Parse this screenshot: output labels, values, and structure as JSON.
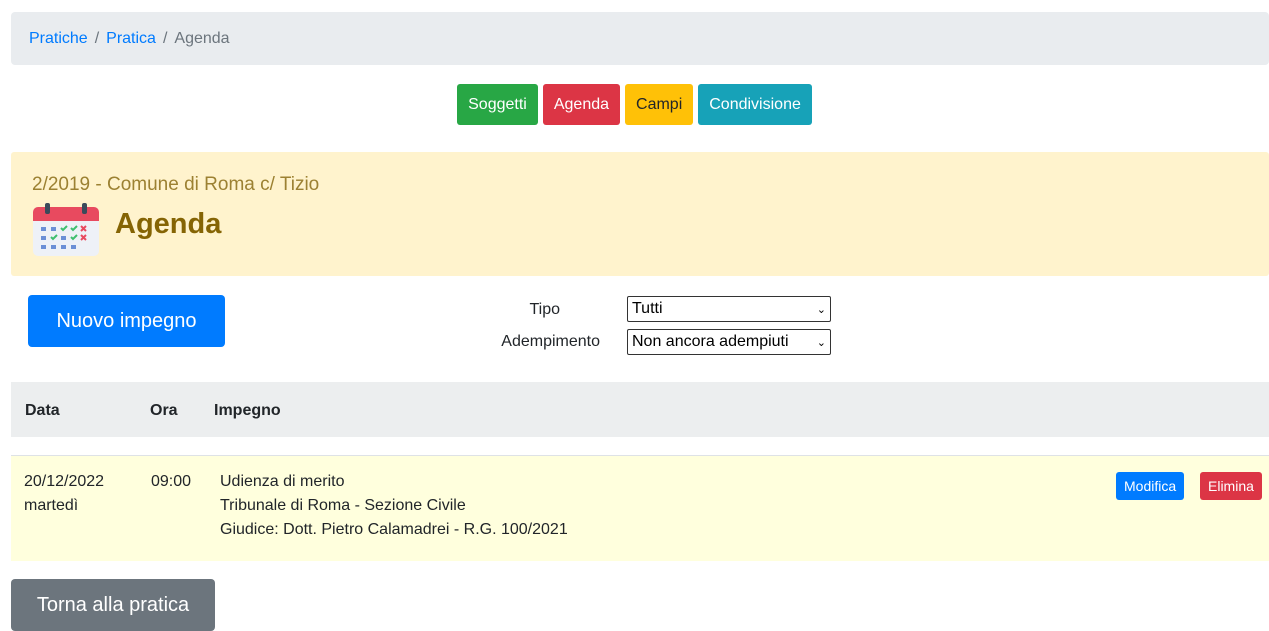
{
  "breadcrumb": {
    "items": [
      {
        "label": "Pratiche"
      },
      {
        "label": "Pratica"
      },
      {
        "label": "Agenda"
      }
    ],
    "separator": "/"
  },
  "nav": {
    "soggetti": "Soggetti",
    "agenda": "Agenda",
    "campi": "Campi",
    "condivisione": "Condivisione"
  },
  "header": {
    "subtitle": "2/2019 - Comune di Roma c/ Tizio",
    "title": "Agenda",
    "icon": "calendar-icon"
  },
  "actions": {
    "new_label": "Nuovo impegno",
    "back_label": "Torna alla pratica"
  },
  "filters": {
    "tipo_label": "Tipo",
    "tipo_value": "Tutti",
    "adempimento_label": "Adempimento",
    "adempimento_value": "Non ancora adempiuti"
  },
  "table": {
    "columns": [
      "Data",
      "Ora",
      "Impegno"
    ],
    "rows": [
      {
        "date": "20/12/2022",
        "weekday": "martedì",
        "time": "09:00",
        "lines": [
          "Udienza di merito",
          "Tribunale di Roma - Sezione Civile",
          "Giudice: Dott. Pietro Calamadrei - R.G. 100/2021"
        ],
        "edit_label": "Modifica",
        "delete_label": "Elimina"
      }
    ]
  },
  "colors": {
    "primary": "#007bff",
    "success": "#28a745",
    "danger": "#dc3545",
    "warning": "#ffc107",
    "info": "#17a2b8",
    "secondary": "#6c757d",
    "header_bg": "#fff3cd",
    "row_bg": "#ffffdd"
  }
}
